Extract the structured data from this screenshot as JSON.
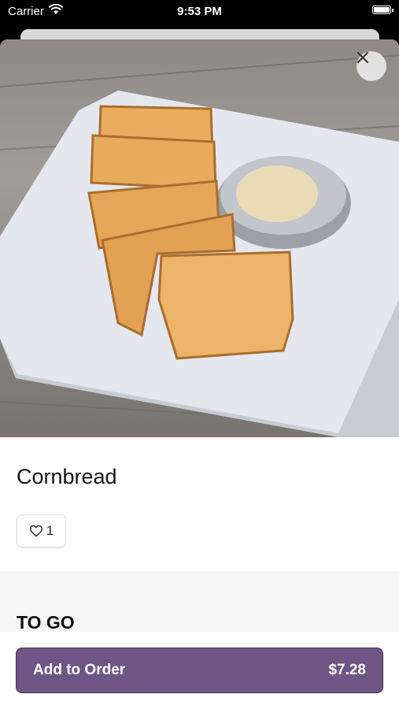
{
  "status_bar": {
    "carrier": "Carrier",
    "time": "9:53 PM"
  },
  "item": {
    "title": "Cornbread",
    "like_count": "1"
  },
  "section": {
    "title": "TO GO"
  },
  "order_button": {
    "label": "Add to Order",
    "price": "$7.28"
  },
  "icons": {
    "close": "close-icon",
    "like": "heart-outline-icon",
    "wifi": "wifi-icon",
    "battery": "battery-icon"
  },
  "colors": {
    "accent": "#6e5585"
  }
}
